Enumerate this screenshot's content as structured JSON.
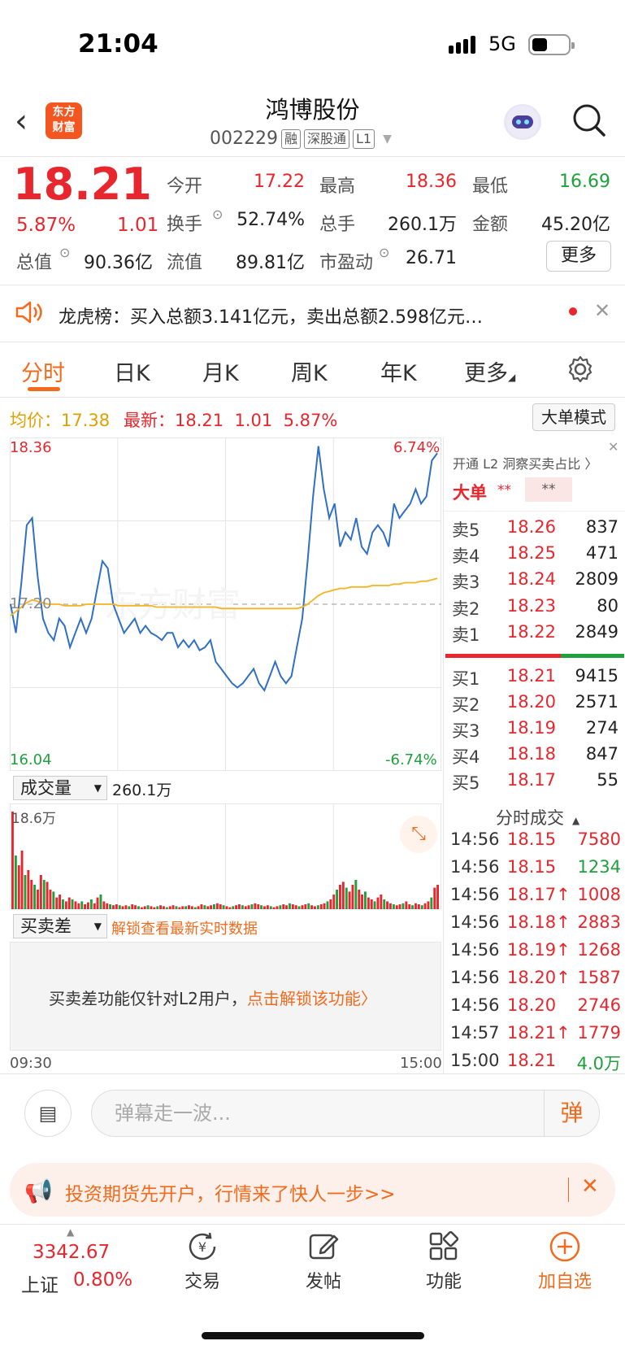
{
  "status": {
    "time": "21:04",
    "network": "5G"
  },
  "header": {
    "logo_line1": "东方",
    "logo_line2": "财富",
    "name": "鸿博股份",
    "code": "002229",
    "tags": [
      "融",
      "深股通",
      "L1"
    ]
  },
  "quote": {
    "price": "18.21",
    "pct": "5.87%",
    "change": "1.01",
    "fields": [
      {
        "label": "今开",
        "value": "17.22",
        "color": "red"
      },
      {
        "label": "最高",
        "value": "18.36",
        "color": "red"
      },
      {
        "label": "最低",
        "value": "16.69",
        "color": "green"
      },
      {
        "label": "换手",
        "value": "52.74%",
        "color": "black"
      },
      {
        "label": "总手",
        "value": "260.1万",
        "color": "black"
      },
      {
        "label": "金额",
        "value": "45.20亿",
        "color": "black"
      },
      {
        "label": "总值",
        "value": "90.36亿",
        "color": "black"
      },
      {
        "label": "流值",
        "value": "89.81亿",
        "color": "black"
      },
      {
        "label": "市盈动",
        "value": "26.71",
        "color": "black"
      }
    ],
    "more_label": "更多"
  },
  "news": {
    "text": "龙虎榜：买入总额3.141亿元，卖出总额2.598亿元…"
  },
  "tabs": [
    "分时",
    "日K",
    "月K",
    "周K",
    "年K",
    "更多"
  ],
  "chart_info": {
    "avg_label": "均价：",
    "avg_value": "17.38",
    "latest_label": "最新：",
    "latest_value": "18.21",
    "latest_change": "1.01",
    "latest_pct": "5.87%",
    "mode_button": "大单模式"
  },
  "chart_data": {
    "type": "line",
    "ylim": [
      16.04,
      18.36
    ],
    "y_labels": {
      "top": "18.36",
      "bottom": "16.04",
      "mid": "17.20",
      "top_pct": "6.74%",
      "bottom_pct": "-6.74%"
    },
    "series": [
      {
        "name": "price",
        "values": [
          17.2,
          17.0,
          17.35,
          17.75,
          17.8,
          17.4,
          17.1,
          17.0,
          16.95,
          17.1,
          17.05,
          16.9,
          17.0,
          17.1,
          17.0,
          17.1,
          17.3,
          17.5,
          17.45,
          17.2,
          17.1,
          17.0,
          17.05,
          17.1,
          17.0,
          17.05,
          17.0,
          16.98,
          16.95,
          17.0,
          17.0,
          16.9,
          16.95,
          16.9,
          16.95,
          16.88,
          16.9,
          16.95,
          16.8,
          16.75,
          16.7,
          16.65,
          16.62,
          16.65,
          16.7,
          16.75,
          16.65,
          16.6,
          16.7,
          16.8,
          16.7,
          16.65,
          16.7,
          16.9,
          17.1,
          17.5,
          17.95,
          18.3,
          18.0,
          17.8,
          17.9,
          17.6,
          17.7,
          17.65,
          17.8,
          17.6,
          17.55,
          17.7,
          17.75,
          17.7,
          17.6,
          17.9,
          17.8,
          17.85,
          17.9,
          18.0,
          17.9,
          17.95,
          18.2,
          18.25
        ]
      },
      {
        "name": "avg",
        "values": [
          17.12,
          17.15,
          17.18,
          17.21,
          17.23,
          17.22,
          17.21,
          17.2,
          17.2,
          17.2,
          17.19,
          17.19,
          17.19,
          17.19,
          17.2,
          17.2,
          17.2,
          17.2,
          17.2,
          17.2,
          17.19,
          17.19,
          17.19,
          17.19,
          17.19,
          17.19,
          17.19,
          17.18,
          17.18,
          17.18,
          17.18,
          17.18,
          17.18,
          17.18,
          17.18,
          17.18,
          17.18,
          17.18,
          17.18,
          17.17,
          17.17,
          17.17,
          17.17,
          17.17,
          17.17,
          17.17,
          17.17,
          17.17,
          17.17,
          17.17,
          17.17,
          17.17,
          17.17,
          17.17,
          17.18,
          17.2,
          17.23,
          17.26,
          17.28,
          17.29,
          17.3,
          17.31,
          17.31,
          17.32,
          17.32,
          17.32,
          17.32,
          17.33,
          17.33,
          17.33,
          17.33,
          17.34,
          17.34,
          17.35,
          17.35,
          17.35,
          17.36,
          17.36,
          17.37,
          17.38
        ]
      }
    ]
  },
  "volume": {
    "select_label": "成交量",
    "total": "260.1万",
    "max_label": "18.6万",
    "bars": [
      1.0,
      0.55,
      0.45,
      0.6,
      0.35,
      0.4,
      0.3,
      0.25,
      0.2,
      0.35,
      0.3,
      0.28,
      0.2,
      0.18,
      0.12,
      0.15,
      0.1,
      0.08,
      0.12,
      0.1,
      0.08,
      0.06,
      0.08,
      0.05,
      0.07,
      0.1,
      0.06,
      0.12,
      0.15,
      0.08,
      0.06,
      0.05,
      0.04,
      0.05,
      0.04,
      0.03,
      0.04,
      0.03,
      0.05,
      0.04,
      0.03,
      0.02,
      0.03,
      0.04,
      0.03,
      0.02,
      0.03,
      0.04,
      0.03,
      0.02,
      0.03,
      0.04,
      0.03,
      0.02,
      0.03,
      0.03,
      0.04,
      0.03,
      0.02,
      0.03,
      0.05,
      0.04,
      0.03,
      0.04,
      0.05,
      0.06,
      0.05,
      0.04,
      0.03,
      0.02,
      0.03,
      0.04,
      0.05,
      0.04,
      0.03,
      0.04,
      0.05,
      0.06,
      0.05,
      0.04,
      0.03,
      0.04,
      0.03,
      0.02,
      0.03,
      0.04,
      0.05,
      0.04,
      0.06,
      0.05,
      0.04,
      0.03,
      0.04,
      0.05,
      0.06,
      0.04,
      0.03,
      0.04,
      0.05,
      0.06,
      0.08,
      0.1,
      0.15,
      0.2,
      0.25,
      0.28,
      0.22,
      0.18,
      0.25,
      0.3,
      0.2,
      0.15,
      0.18,
      0.12,
      0.1,
      0.08,
      0.12,
      0.15,
      0.1,
      0.08,
      0.06,
      0.05,
      0.04,
      0.05,
      0.06,
      0.08,
      0.05,
      0.04,
      0.06,
      0.05,
      0.04,
      0.06,
      0.08,
      0.12,
      0.22,
      0.25
    ],
    "bar_colors_red": "#e8262d",
    "bar_colors_green": "#1fa03c"
  },
  "diff": {
    "select_label": "买卖差",
    "unlock_text": "解锁查看最新实时数据",
    "msg_plain": "买卖差功能仅针对L2用户，",
    "msg_link": "点击解锁该功能〉",
    "time_start": "09:30",
    "time_end": "15:00"
  },
  "l2": {
    "title": "开通 L2 洞察买卖占比 〉",
    "big_label": "大单",
    "stars": "**"
  },
  "orderbook": {
    "asks": [
      {
        "name": "卖5",
        "price": "18.26",
        "vol": "837"
      },
      {
        "name": "卖4",
        "price": "18.25",
        "vol": "471"
      },
      {
        "name": "卖3",
        "price": "18.24",
        "vol": "2809"
      },
      {
        "name": "卖2",
        "price": "18.23",
        "vol": "80"
      },
      {
        "name": "卖1",
        "price": "18.22",
        "vol": "2849"
      }
    ],
    "bids": [
      {
        "name": "买1",
        "price": "18.21",
        "vol": "9415"
      },
      {
        "name": "买2",
        "price": "18.20",
        "vol": "2571"
      },
      {
        "name": "买3",
        "price": "18.19",
        "vol": "274"
      },
      {
        "name": "买4",
        "price": "18.18",
        "vol": "847"
      },
      {
        "name": "买5",
        "price": "18.17",
        "vol": "55"
      }
    ]
  },
  "ticks": {
    "title": "分时成交",
    "rows": [
      {
        "time": "14:56",
        "price": "18.15",
        "vol": "7580",
        "color": "red"
      },
      {
        "time": "14:56",
        "price": "18.15",
        "vol": "1234",
        "color": "green"
      },
      {
        "time": "14:56",
        "price": "18.17↑",
        "vol": "1008",
        "color": "red"
      },
      {
        "time": "14:56",
        "price": "18.18↑",
        "vol": "2883",
        "color": "red"
      },
      {
        "time": "14:56",
        "price": "18.19↑",
        "vol": "1268",
        "color": "red"
      },
      {
        "time": "14:56",
        "price": "18.20↑",
        "vol": "1587",
        "color": "red"
      },
      {
        "time": "14:56",
        "price": "18.20",
        "vol": "2746",
        "color": "red"
      },
      {
        "time": "14:57",
        "price": "18.21↑",
        "vol": "1779",
        "color": "red"
      },
      {
        "time": "15:00",
        "price": "18.21",
        "vol": "4.0万",
        "color": "green"
      }
    ]
  },
  "danmu": {
    "placeholder": "弹幕走一波...",
    "send": "弹"
  },
  "ad": {
    "text": "投资期货先开户，行情来了快人一步>>"
  },
  "bottom": {
    "index_value": "3342.67",
    "index_name": "上证",
    "index_pct": "0.80%",
    "nav": [
      {
        "label": "交易",
        "icon": "yen-icon"
      },
      {
        "label": "发帖",
        "icon": "edit-icon"
      },
      {
        "label": "功能",
        "icon": "grid-icon"
      },
      {
        "label": "加自选",
        "icon": "plus-circle-icon"
      }
    ]
  },
  "colors": {
    "accent": "#f26b1d",
    "up": "#e8262d",
    "down": "#1fa03c",
    "avg_line": "#f5b321",
    "price_line": "#2f6fc7"
  }
}
